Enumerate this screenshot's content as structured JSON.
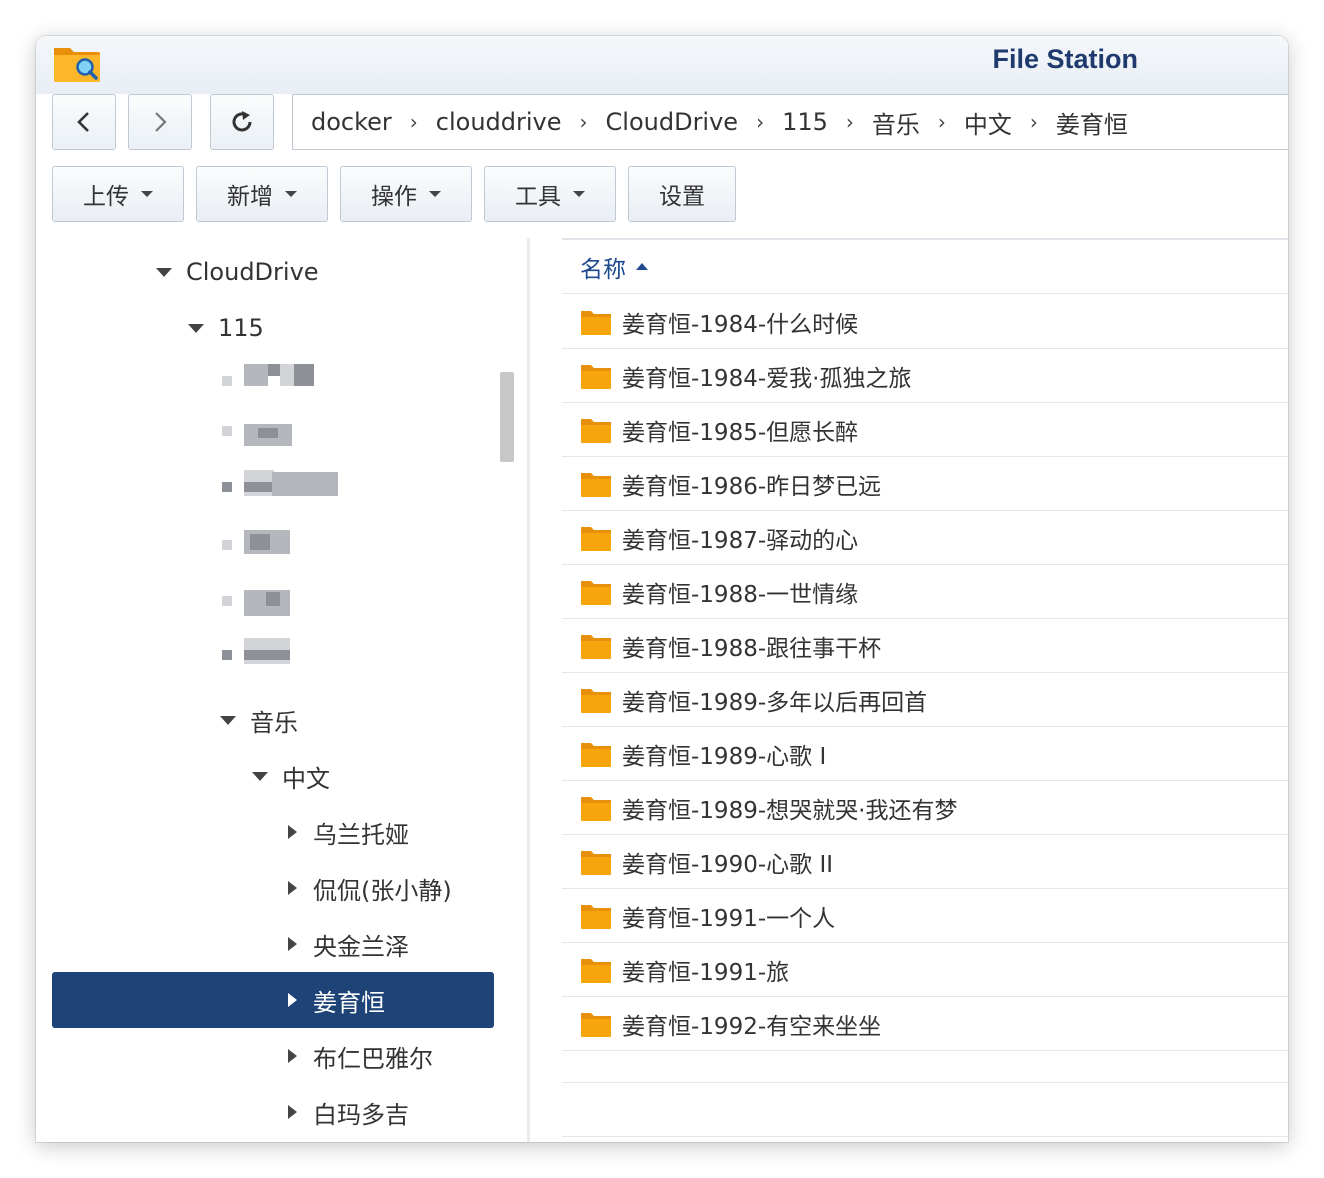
{
  "window": {
    "title": "File Station"
  },
  "toolbar": {
    "back_icon": "chevron-left-icon",
    "forward_icon": "chevron-right-icon",
    "refresh_icon": "refresh-icon"
  },
  "breadcrumb": [
    "docker",
    "clouddrive",
    "CloudDrive",
    "115",
    "音乐",
    "中文",
    "姜育恒"
  ],
  "actions": {
    "upload": "上传",
    "create": "新增",
    "operate": "操作",
    "tools": "工具",
    "settings": "设置"
  },
  "tree": {
    "cloud_drive": "CloudDrive",
    "folder_115": "115",
    "music": "音乐",
    "chinese": "中文",
    "artists": [
      "乌兰托娅",
      "侃侃(张小静)",
      "央金兰泽",
      "姜育恒",
      "布仁巴雅尔",
      "白玛多吉"
    ],
    "selected": "姜育恒"
  },
  "list": {
    "column_name": "名称",
    "sort_order": "ascending",
    "items": [
      "姜育恒-1984-什么时候",
      "姜育恒-1984-爱我·孤独之旅",
      "姜育恒-1985-但愿长醉",
      "姜育恒-1986-昨日梦已远",
      "姜育恒-1987-驿动的心",
      "姜育恒-1988-一世情缘",
      "姜育恒-1988-跟往事干杯",
      "姜育恒-1989-多年以后再回首",
      "姜育恒-1989-心歌 I",
      "姜育恒-1989-想哭就哭·我还有梦",
      "姜育恒-1990-心歌 II",
      "姜育恒-1991-一个人",
      "姜育恒-1991-旅",
      "姜育恒-1992-有空来坐坐"
    ]
  },
  "colors": {
    "accent": "#1d4377",
    "title": "#1f3b6e",
    "folder": "#f7a50c",
    "header_text": "#1f4b8e"
  }
}
